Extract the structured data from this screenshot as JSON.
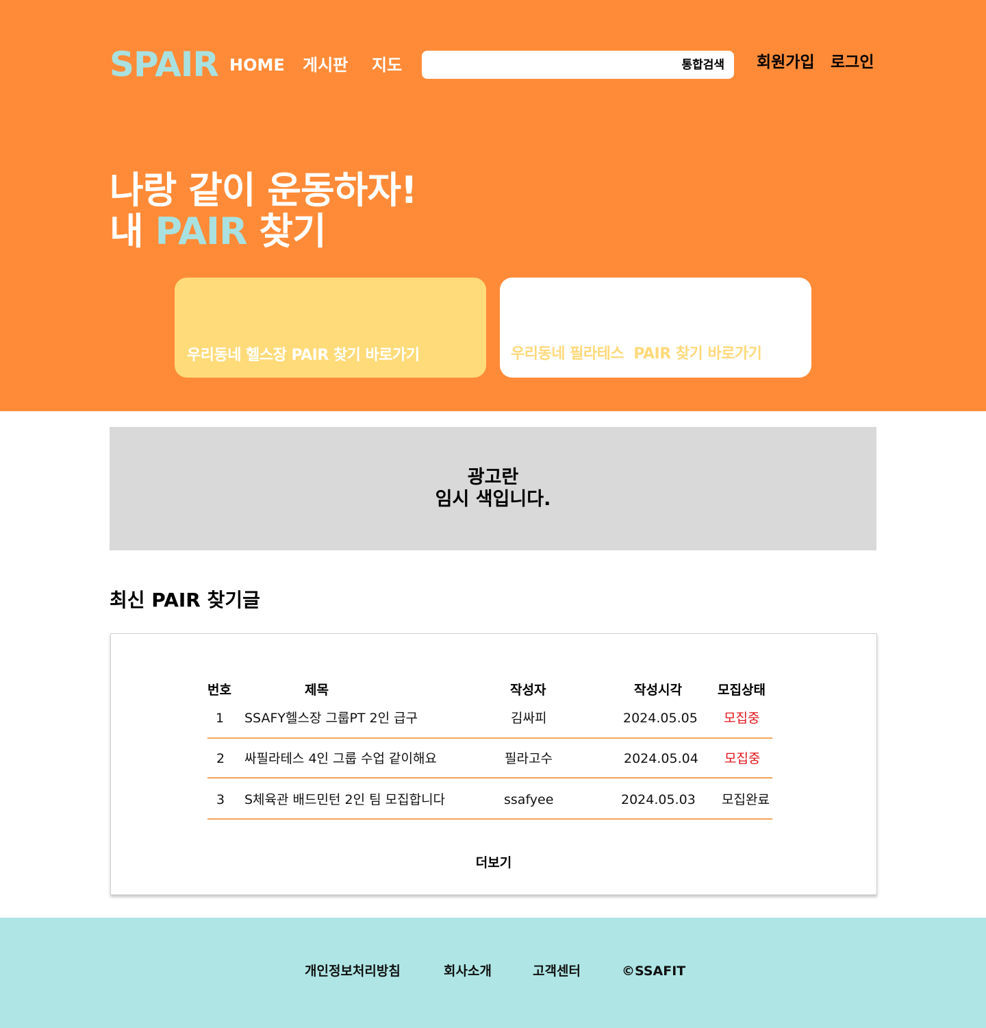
{
  "colors": {
    "hero_bg": "#ff8b38",
    "accent_teal": "#a8e1df",
    "card_yellow": "#ffdb7a",
    "card_white": "#ffffff",
    "card2_label": "#ffd97a",
    "ad_bg": "#d9d9d9",
    "recruiting": "#e0141a",
    "row_divider": "#f5a35c",
    "footer_bg": "#afe6e5"
  },
  "header": {
    "logo": "SPAIR",
    "nav": [
      "HOME",
      "게시판",
      "지도"
    ],
    "search": {
      "placeholder": "",
      "button": "통합검색"
    },
    "signup": "회원가입",
    "login": "로그인"
  },
  "hero": {
    "line1": "나랑 같이 운동하자!",
    "line2_prefix": "내 ",
    "line2_highlight": "PAIR",
    "line2_suffix": " 찾기"
  },
  "cards": [
    {
      "label": "우리동네 헬스장 PAIR 찾기 바로가기"
    },
    {
      "label": "우리동네 필라테스  PAIR 찾기 바로가기"
    }
  ],
  "ad": {
    "line1": "광고란",
    "line2": "임시 색입니다."
  },
  "recent": {
    "title": "최신 PAIR 찾기글",
    "columns": [
      "번호",
      "제목",
      "작성자",
      "작성시각",
      "모집상태"
    ],
    "rows": [
      {
        "no": "1",
        "title": "SSAFY헬스장 그룹PT 2인 급구",
        "author": "김싸피",
        "time": "2024.05.05",
        "status": "모집중",
        "status_color": "#e0141a"
      },
      {
        "no": "2",
        "title": "싸필라테스 4인 그룹 수업 같이해요",
        "author": "필라고수",
        "time": "2024.05.04",
        "status": "모집중",
        "status_color": "#e0141a"
      },
      {
        "no": "3",
        "title": "S체육관 배드민턴 2인 팀 모집합니다",
        "author": "ssafyee",
        "time": "2024.05.03",
        "status": "모집완료",
        "status_color": "#111111"
      }
    ],
    "more": "더보기"
  },
  "footer": {
    "links": [
      "개인정보처리방침",
      "회사소개",
      "고객센터",
      "©SSAFIT"
    ]
  }
}
